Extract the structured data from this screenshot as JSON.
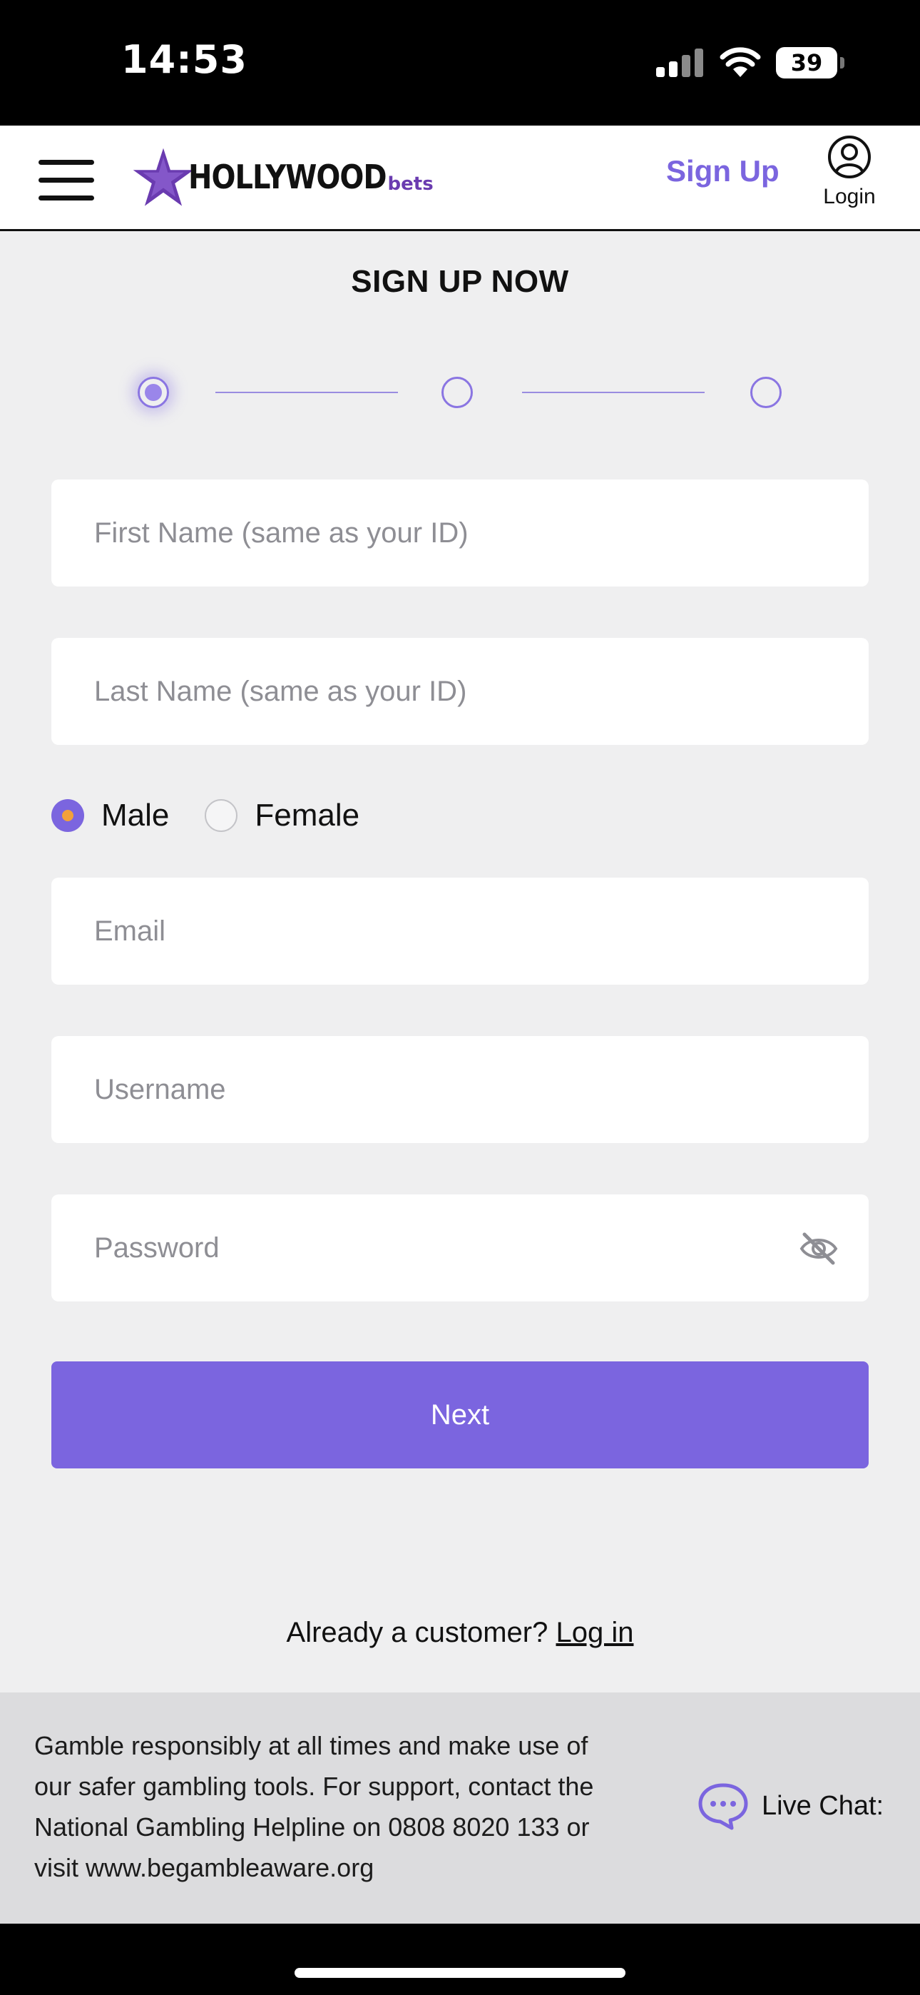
{
  "status_bar": {
    "time": "14:53",
    "battery": "39",
    "icons": [
      "signal-icon",
      "wifi-icon",
      "battery-icon"
    ]
  },
  "header": {
    "logo_main": "HOLLYWOOD",
    "logo_sub": "bets",
    "signup_label": "Sign Up",
    "login_label": "Login"
  },
  "form": {
    "title": "SIGN UP NOW",
    "steps": [
      "step-1",
      "step-2",
      "step-3"
    ],
    "active_step": 1,
    "first_name_placeholder": "First Name (same as your ID)",
    "last_name_placeholder": "Last Name (same as your ID)",
    "gender_options": [
      "Male",
      "Female"
    ],
    "gender_selected": "Male",
    "email_placeholder": "Email",
    "username_placeholder": "Username",
    "password_placeholder": "Password",
    "next_label": "Next"
  },
  "already": {
    "text": "Already a customer? ",
    "link": "Log in"
  },
  "footer": {
    "disclaimer": "Gamble responsibly at all times and make use of our safer gambling tools. For support, contact the National Gambling Helpline on 0808 8020 133 or visit www.begambleaware.org",
    "live_chat_label": "Live Chat:"
  },
  "colors": {
    "accent": "#7b65df",
    "radio_dot": "#f2a13b",
    "background": "#efeff0",
    "footer_bg": "#dcdcde"
  }
}
